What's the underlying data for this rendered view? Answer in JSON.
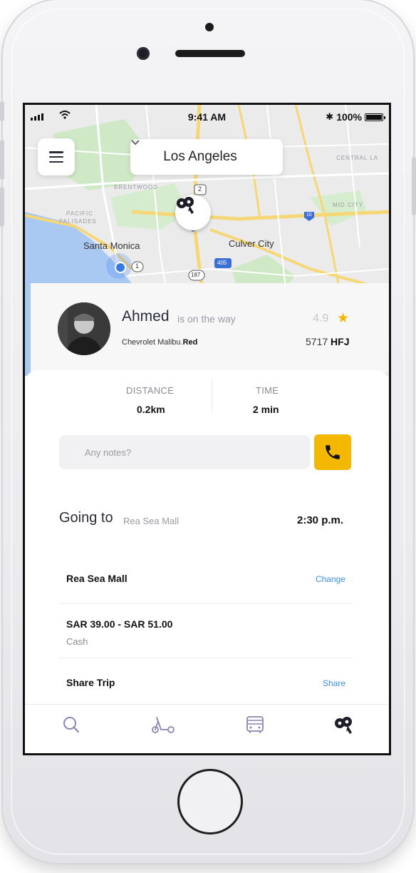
{
  "status_bar": {
    "time": "9:41 AM",
    "battery": "100%",
    "wifi_icon": "wifi-icon",
    "bluetooth_icon": "bluetooth-icon"
  },
  "top": {
    "city": "Los Angeles"
  },
  "map": {
    "labels": {
      "santa_monica": "Santa Monica",
      "culver_city": "Culver City",
      "brentwood": "BRENTWOOD",
      "pacific_palisades_1": "PACIFIC",
      "pacific_palisades_2": "PALISADES",
      "mid_city": "MID CITY",
      "central_la": "CENTRAL LA"
    },
    "shields": {
      "s2": "2",
      "s10": "10",
      "s405": "405",
      "s1": "1",
      "s187": "187"
    }
  },
  "driver": {
    "name": "Ahmed",
    "status": "is on the way",
    "rating": "4.9",
    "car_model": "Chevrolet Malibu.",
    "car_color": "Red",
    "plate_number": "5717",
    "plate_code": "HFJ"
  },
  "trip": {
    "distance_label": "DISTANCE",
    "distance_value": "0.2km",
    "time_label": "TIME",
    "time_value": "2 min",
    "notes_placeholder": "Any notes?",
    "going_to_label": "Going to",
    "destination": "Rea Sea Mall",
    "eta": "2:30 p.m."
  },
  "rows": {
    "destination_title": "Rea Sea Mall",
    "change_label": "Change",
    "fare_title": "SAR 39.00 - SAR 51.00",
    "fare_method": "Cash",
    "share_title": "Share Trip",
    "share_label": "Share"
  },
  "nav": {
    "items": [
      "search",
      "scooter",
      "bus",
      "ride"
    ]
  },
  "colors": {
    "accent": "#f5b800",
    "link": "#3d8ee3",
    "star": "#f5b400",
    "nav_icon": "#8a86b4"
  }
}
